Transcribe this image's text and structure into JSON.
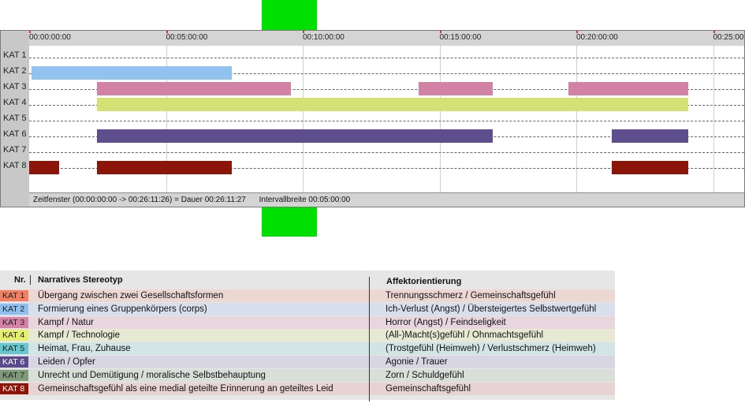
{
  "timeline": {
    "ticks": [
      "00:00:00:00",
      "00:05:00:00",
      "00:10:00:00",
      "00:15:00:00",
      "00:20:00:00",
      "00:25:00"
    ],
    "rows": [
      {
        "label": "KAT 1",
        "color": "#e8866a",
        "segments": []
      },
      {
        "label": "KAT 2",
        "color": "#92c2ef",
        "segments": [
          [
            0.08,
            7.42
          ]
        ]
      },
      {
        "label": "KAT 3",
        "color": "#d283a5",
        "segments": [
          [
            2.47,
            9.58
          ],
          [
            14.25,
            16.95
          ],
          [
            19.7,
            24.1
          ]
        ]
      },
      {
        "label": "KAT 4",
        "color": "#d2e274",
        "segments": [
          [
            2.47,
            24.1
          ]
        ]
      },
      {
        "label": "KAT 5",
        "color": "#7fcfd6",
        "segments": []
      },
      {
        "label": "KAT 6",
        "color": "#5f4e8e",
        "segments": [
          [
            2.47,
            16.95
          ],
          [
            21.3,
            24.1
          ]
        ]
      },
      {
        "label": "KAT 7",
        "color": "#8aa885",
        "segments": []
      },
      {
        "label": "KAT 8",
        "color": "#8b1508",
        "segments": [
          [
            0.0,
            1.1
          ],
          [
            2.47,
            7.42
          ],
          [
            21.3,
            24.1
          ]
        ]
      }
    ],
    "status": {
      "zeitfenster": "Zeitfenster (00:00:00:00 -> 00:26:11:26) = Dauer 00:26:11:27",
      "intervall": "Intervallbreite 00:05:00:00"
    }
  },
  "legend": {
    "header_nr": "Nr.",
    "header_stereotyp": "Narratives Stereotyp",
    "header_affekt": "Affektorientierung",
    "rows": [
      {
        "nr": "KAT 1",
        "color": "#f08060",
        "bg": "#ecd7d2",
        "text_color": "#222222",
        "stereotyp": "Übergang zwischen zwei Gesellschaftsformen",
        "affekt": "Trennungsschmerz / Gemeinschaftsgefühl"
      },
      {
        "nr": "KAT 2",
        "color": "#8dc0ef",
        "bg": "#d6dfeb",
        "text_color": "#222222",
        "stereotyp": "Formierung eines Gruppenkörpers (corps)",
        "affekt": "Ich-Verlust (Angst) / Übersteigertes Selbstwertgefühl"
      },
      {
        "nr": "KAT 3",
        "color": "#d582a6",
        "bg": "#e8d5de",
        "text_color": "#222222",
        "stereotyp": "Kampf / Natur",
        "affekt": "Horror (Angst) / Feindseligkeit"
      },
      {
        "nr": "KAT 4",
        "color": "#e6ee70",
        "bg": "#e7e9d2",
        "text_color": "#222222",
        "stereotyp": "Kampf / Technologie",
        "affekt": "(All-)Macht(s)gefühl / Ohnmachtsgefühl"
      },
      {
        "nr": "KAT 5",
        "color": "#66c8cf",
        "bg": "#d3e4e4",
        "text_color": "#222222",
        "stereotyp": "Heimat, Frau, Zuhause",
        "affekt": "(Trostgefühl (Heimweh) / Verlustschmerz (Heimweh)"
      },
      {
        "nr": "KAT 6",
        "color": "#5b4a8b",
        "bg": "#d8d6e2",
        "text_color": "#ffffff",
        "stereotyp": "Leiden / Opfer",
        "affekt": "Agonie / Trauer"
      },
      {
        "nr": "KAT 7",
        "color": "#7e9a78",
        "bg": "#d9dfd8",
        "text_color": "#222222",
        "stereotyp": "Unrecht und Demütigung / moralische Selbstbehauptung",
        "affekt": "Zorn / Schuldgefühl"
      },
      {
        "nr": "KAT 8",
        "color": "#8e1408",
        "bg": "#e8d3d3",
        "text_color": "#ffffff",
        "stereotyp": "Gemeinschaftsgefühl als eine medial geteilte Erinnerung an geteiltes Leid",
        "affekt": "Gemeinschaftsgefühl"
      }
    ]
  }
}
